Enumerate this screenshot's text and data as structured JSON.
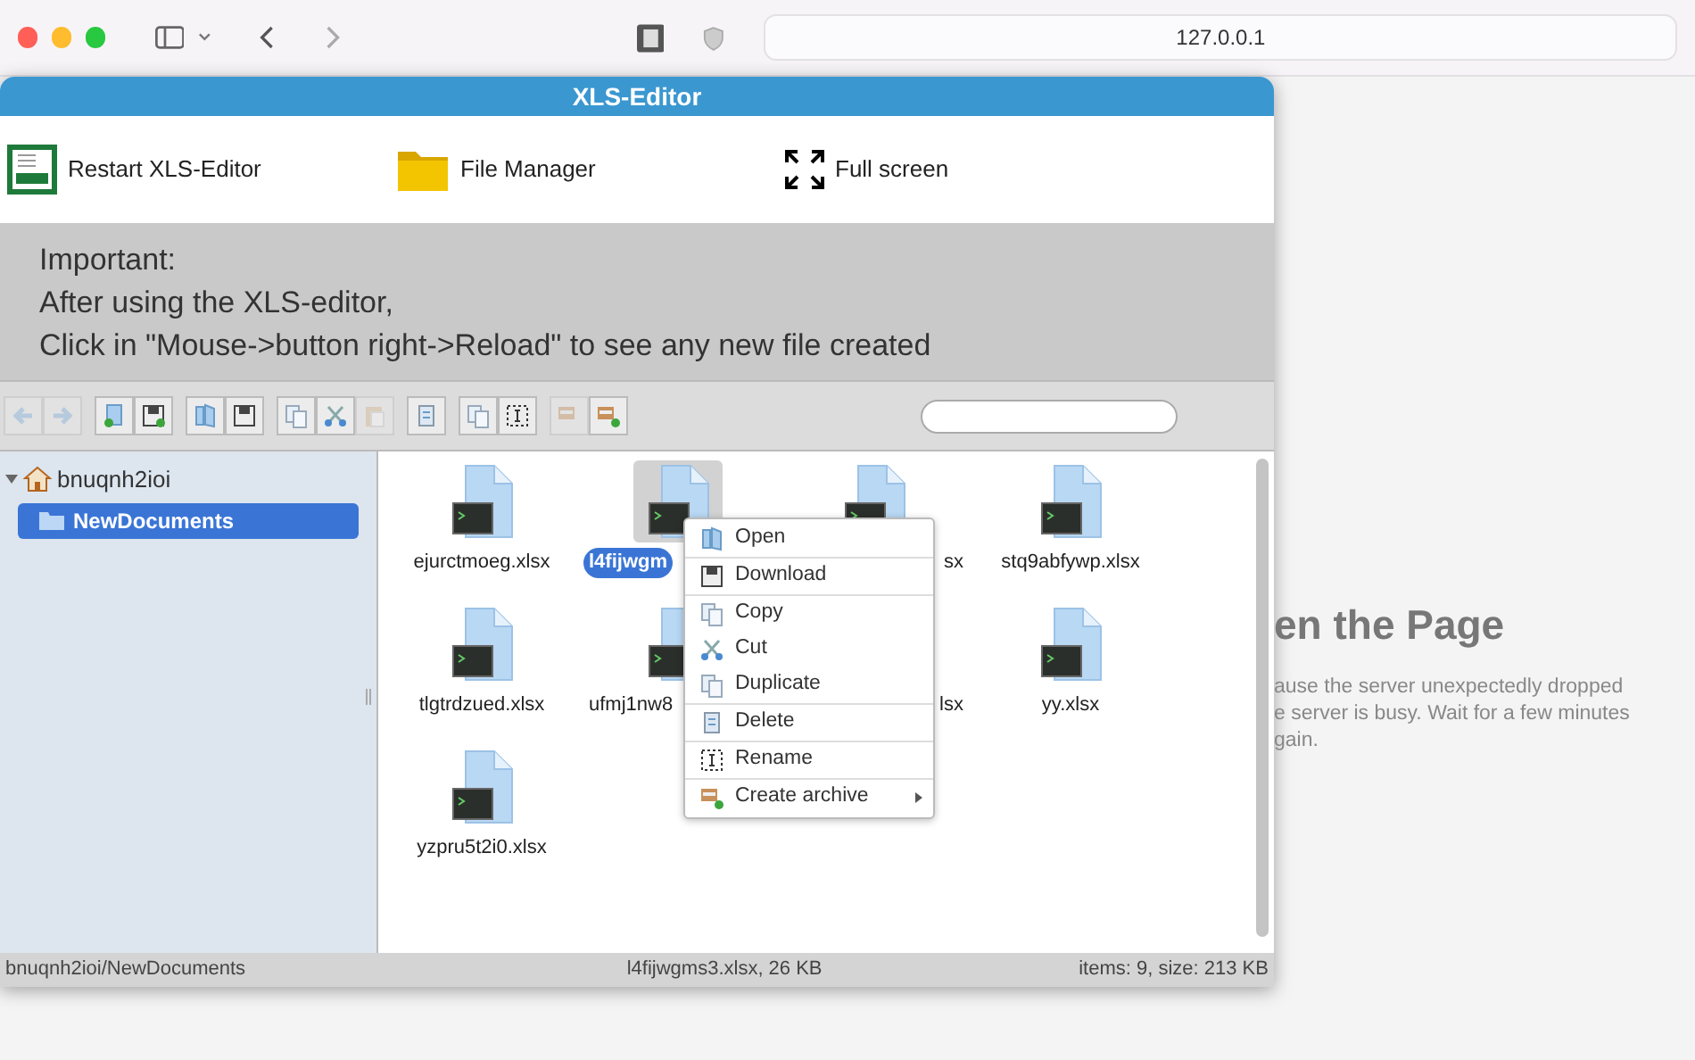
{
  "browser": {
    "url": "127.0.0.1",
    "page_heading": "en the Page",
    "page_lines": [
      "ause the server unexpectedly dropped",
      "e server is busy. Wait for a few minutes",
      "gain."
    ]
  },
  "editor": {
    "title": "XLS-Editor",
    "actions": [
      {
        "label": "Restart XLS-Editor",
        "kind": "xls"
      },
      {
        "label": "File Manager",
        "kind": "folder"
      },
      {
        "label": "Full screen",
        "kind": "fullscreen"
      }
    ],
    "notice": [
      "Important:",
      "After using the XLS-editor,",
      "Click in \"Mouse->button right->Reload\" to see any new file created"
    ],
    "toolbar": [
      [
        {
          "kind": "back",
          "disabled": true
        },
        {
          "kind": "forward",
          "disabled": true
        }
      ],
      [
        {
          "kind": "upload",
          "disabled": false
        },
        {
          "kind": "save",
          "disabled": false
        }
      ],
      [
        {
          "kind": "open",
          "disabled": false
        },
        {
          "kind": "download",
          "disabled": false
        }
      ],
      [
        {
          "kind": "copy",
          "disabled": false
        },
        {
          "kind": "cut",
          "disabled": false
        },
        {
          "kind": "paste",
          "disabled": true
        }
      ],
      [
        {
          "kind": "delete",
          "disabled": false
        }
      ],
      [
        {
          "kind": "duplicate",
          "disabled": false
        },
        {
          "kind": "rename",
          "disabled": false
        }
      ],
      [
        {
          "kind": "extract",
          "disabled": true
        },
        {
          "kind": "archive",
          "disabled": false
        }
      ]
    ],
    "tree": [
      {
        "label": "bnuqnh2ioi",
        "expanded": true,
        "children": [
          {
            "label": "NewDocuments",
            "selected": true
          }
        ]
      }
    ],
    "files": [
      {
        "name": "ejurctmoeg.xlsx",
        "selected": false,
        "kind": "whole"
      },
      {
        "name": "l4fijwgm",
        "selected": true,
        "kind": "tail_hidden"
      },
      {
        "name": "sx",
        "selected": false,
        "kind": "head_hidden"
      },
      {
        "name": "stq9abfywp.xlsx",
        "selected": false,
        "kind": "whole"
      },
      {
        "name": "tlgtrdzued.xlsx",
        "selected": false,
        "kind": "whole"
      },
      {
        "name": "ufmj1nw8",
        "selected": false,
        "kind": "right_half_hidden"
      },
      {
        "name": "lsx",
        "selected": false,
        "kind": "only_tail_shown"
      },
      {
        "name": "yy.xlsx",
        "selected": false,
        "kind": "whole"
      },
      {
        "name": "yzpru5t2i0.xlsx",
        "selected": false,
        "kind": "whole"
      }
    ],
    "context_menu": [
      [
        {
          "label": "Open",
          "kind": "open",
          "submenu": false
        }
      ],
      [
        {
          "label": "Download",
          "kind": "download",
          "submenu": false
        }
      ],
      [
        {
          "label": "Copy",
          "kind": "copy",
          "submenu": false
        },
        {
          "label": "Cut",
          "kind": "cut",
          "submenu": false
        },
        {
          "label": "Duplicate",
          "kind": "duplicate",
          "submenu": false
        }
      ],
      [
        {
          "label": "Delete",
          "kind": "delete",
          "submenu": false
        }
      ],
      [
        {
          "label": "Rename",
          "kind": "rename",
          "submenu": false
        }
      ],
      [
        {
          "label": "Create archive",
          "kind": "archive",
          "submenu": true
        }
      ]
    ],
    "status_bar": {
      "path": "bnuqnh2ioi/NewDocuments",
      "selection": "l4fijwgms3.xlsx, 26 KB",
      "summary": "items: 9, size: 213 KB"
    }
  }
}
